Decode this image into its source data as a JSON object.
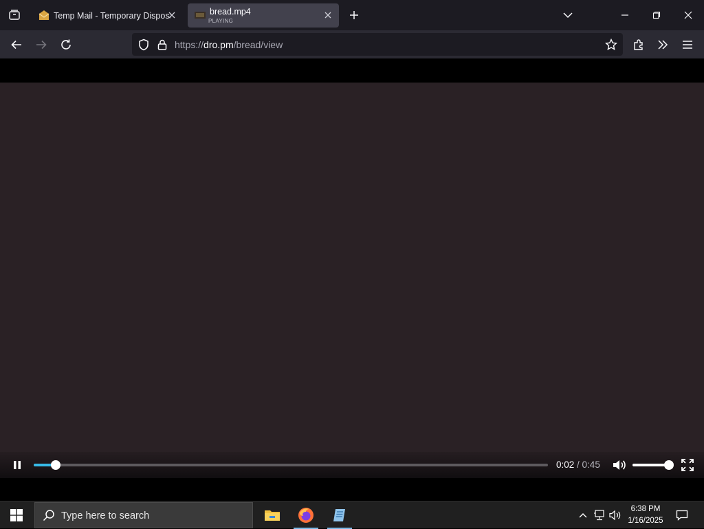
{
  "browser": {
    "tabs": [
      {
        "title": "Temp Mail - Temporary Disposable Email",
        "subtitle": "",
        "active": false
      },
      {
        "title": "bread.mp4",
        "subtitle": "PLAYING",
        "active": true
      }
    ],
    "url": {
      "scheme": "https://",
      "host": "dro.pm",
      "path": "/bread/view"
    }
  },
  "player": {
    "state": "playing",
    "current_time": "0:02",
    "separator": " / ",
    "duration": "0:45",
    "progress_fraction": 0.043,
    "volume_fraction": 1.0,
    "accent_color": "#37bbe8",
    "video_background": "#2a2125"
  },
  "taskbar": {
    "search_placeholder": "Type here to search",
    "apps": [
      "file-explorer",
      "firefox",
      "notepad-app"
    ],
    "time": "6:38 PM",
    "date": "1/16/2025"
  }
}
